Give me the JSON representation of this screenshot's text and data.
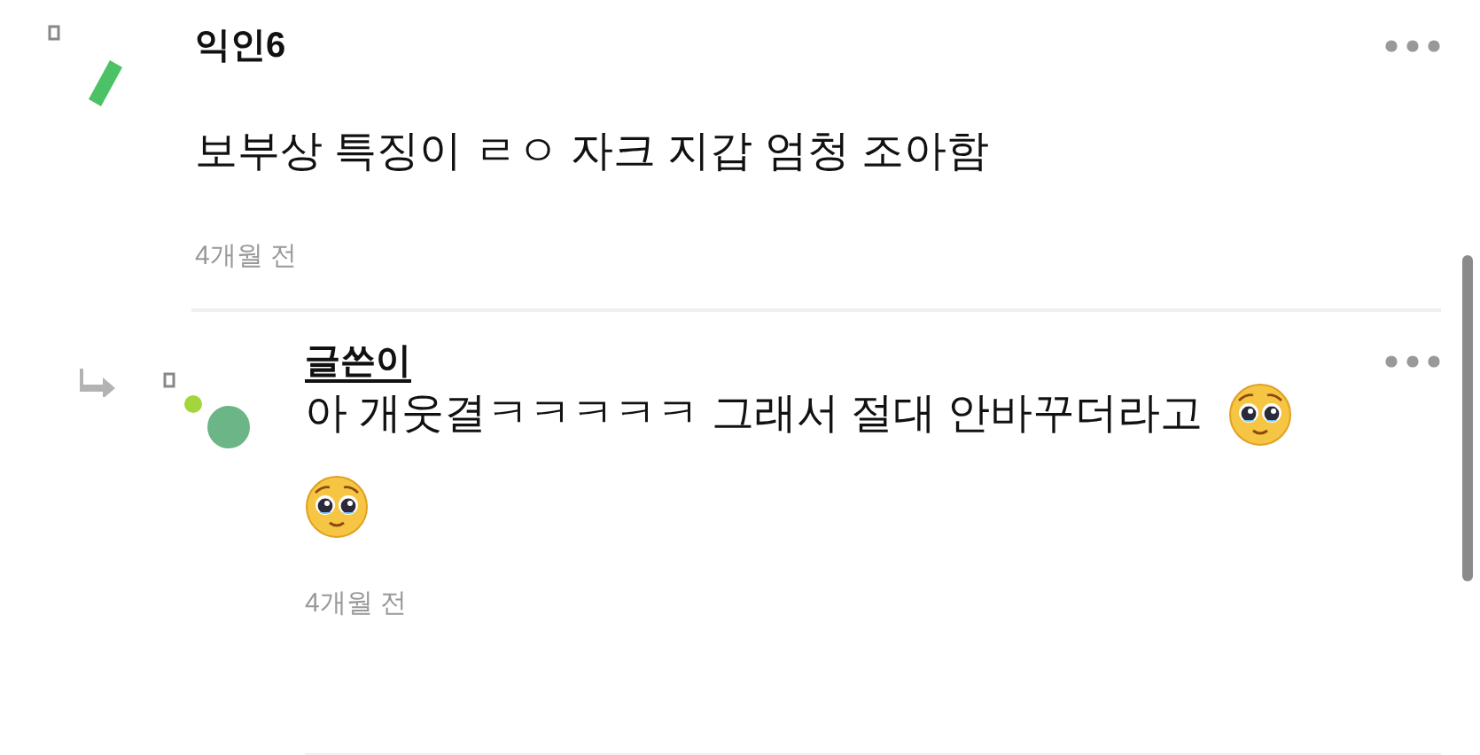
{
  "comments": [
    {
      "kind": "comment",
      "author": "익인6",
      "text": "보부상 특징이 ㄹㅇ 자크 지갑 엄청 조아함",
      "time": "4개월 전"
    },
    {
      "kind": "reply",
      "author": "글쓴이",
      "text": "아 개웃결ㅋㅋㅋㅋㅋ 그래서 절대 안바꾸더라고",
      "time": "4개월 전"
    }
  ]
}
